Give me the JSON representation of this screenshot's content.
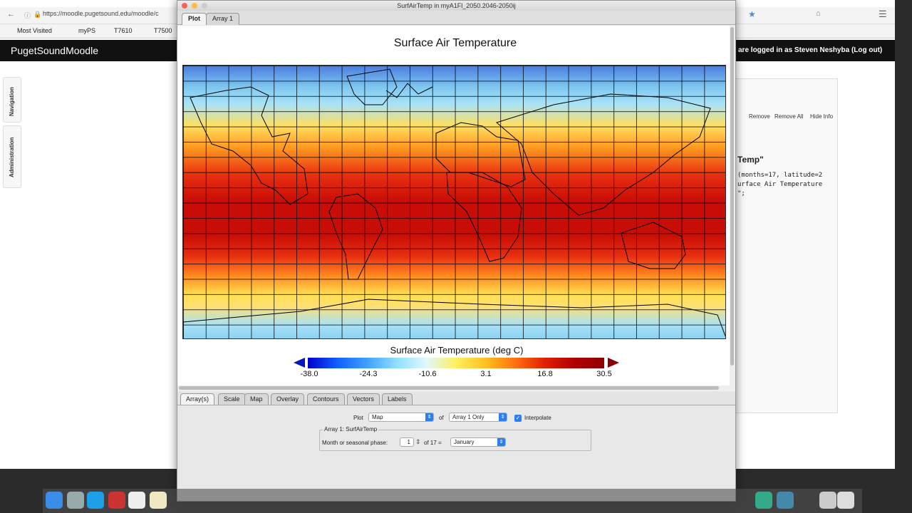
{
  "browser": {
    "url": "https://moodle.pugetsound.edu/moodle/c",
    "bookmarks": [
      "Most Visited",
      "myPS",
      "T7610",
      "T7500"
    ]
  },
  "moodle": {
    "site_title": "PugetSoundMoodle",
    "logged_in_text": "are logged in as Steven Neshyba (Log out)",
    "side_tabs": [
      "Navigation",
      "Administration"
    ],
    "panel_buttons": [
      "Remove",
      "Remove All",
      "Hide Info"
    ],
    "panel_heading": "Temp\"",
    "code_lines": [
      "(months=17, latitude=2",
      "urface Air Temperature",
      "\";"
    ]
  },
  "window": {
    "title": "SurfAirTemp in myA1Fl_2050.2046-2050ij",
    "tabs": [
      "Plot",
      "Array 1"
    ],
    "active_tab": "Plot"
  },
  "plot": {
    "title": "Surface Air Temperature",
    "colorbar_title": "Surface Air Temperature (deg C)",
    "colorbar_ticks": [
      "-38.0",
      "-24.3",
      "-10.6",
      "3.1",
      "16.8",
      "30.5"
    ],
    "colorbar_min": -38.0,
    "colorbar_max": 30.5
  },
  "controls": {
    "tabs": [
      "Array(s)",
      "Scale",
      "Map",
      "Overlay",
      "Contours",
      "Vectors",
      "Labels"
    ],
    "active_tab": "Array(s)",
    "plot_label": "Plot",
    "plot_value": "Map",
    "of_label": "of",
    "array_value": "Array 1 Only",
    "interpolate_label": "Interpolate",
    "interpolate_checked": true,
    "group_legend": "Array 1: SurfAirTemp",
    "month_label": "Month or seasonal phase:",
    "month_value": "1",
    "of_total": "of 17 =",
    "month_name": "January"
  }
}
